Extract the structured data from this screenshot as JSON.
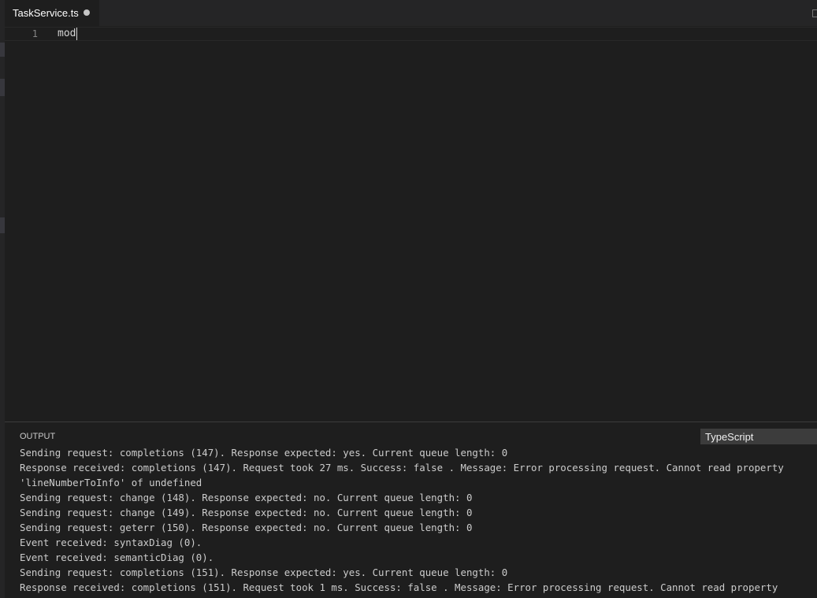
{
  "tab": {
    "label": "TaskService.ts",
    "dirty": true
  },
  "editor": {
    "line_number": "1",
    "code": "mod"
  },
  "panel": {
    "title": "OUTPUT",
    "channel": "TypeScript",
    "lines": [
      "Sending request: completions (147). Response expected: yes. Current queue length: 0",
      "Response received: completions (147). Request took 27 ms. Success: false . Message: Error processing request. Cannot read property",
      "'lineNumberToInfo' of undefined",
      "Sending request: change (148). Response expected: no. Current queue length: 0",
      "Sending request: change (149). Response expected: no. Current queue length: 0",
      "Sending request: geterr (150). Response expected: no. Current queue length: 0",
      "Event received: syntaxDiag (0).",
      "Event received: semanticDiag (0).",
      "Sending request: completions (151). Response expected: yes. Current queue length: 0",
      "Response received: completions (151). Request took 1 ms. Success: false . Message: Error processing request. Cannot read property"
    ]
  },
  "colors": {
    "editor_background": "#1e1e1e",
    "tabbar_background": "#252526",
    "text": "#d4d4d4",
    "line_number": "#858585"
  }
}
